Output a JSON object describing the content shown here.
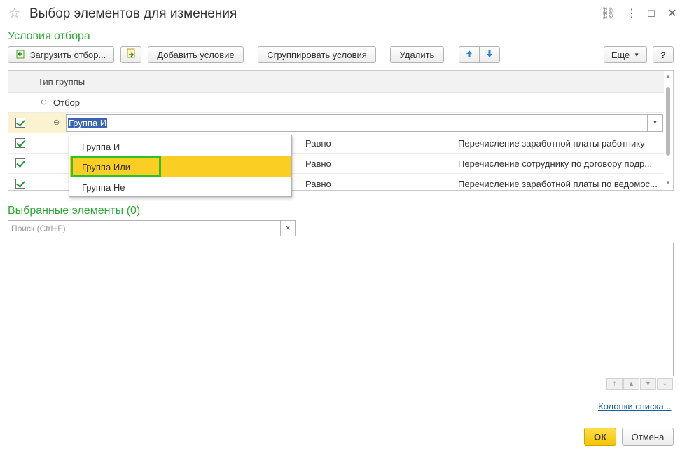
{
  "window": {
    "title": "Выбор элементов для изменения",
    "link_icon": "⛓",
    "menu_icon": "⋮",
    "maximize_icon": "☐",
    "close_icon": "✕"
  },
  "filter": {
    "section_title": "Условия отбора",
    "toolbar": {
      "load_filter": "Загрузить отбор...",
      "add_condition": "Добавить условие",
      "group_conditions": "Сгруппировать условия",
      "delete": "Удалить",
      "more": "Еще",
      "help": "?"
    },
    "table": {
      "header": "Тип группы",
      "rows": [
        {
          "label": "Отбор"
        },
        {
          "label": "Группа И",
          "checked": true
        },
        {
          "checked": true,
          "condition": "Равно",
          "value": "Перечисление заработной платы работнику"
        },
        {
          "checked": true,
          "condition": "Равно",
          "value": "Перечисление сотруднику по договору подр..."
        },
        {
          "checked": true,
          "condition": "Равно",
          "value": "Перечисление заработной платы по ведомос..."
        }
      ]
    },
    "dropdown": {
      "options": [
        "Группа И",
        "Группа Или",
        "Группа Не"
      ],
      "selected": "Группа Или"
    }
  },
  "selected": {
    "section_title": "Выбранные элементы (0)",
    "search_placeholder": "Поиск (Ctrl+F)",
    "clear": "×"
  },
  "footer": {
    "columns_link": "Колонки списка...",
    "ok": "ОК",
    "cancel": "Отмена"
  },
  "colors": {
    "accent_green": "#2ea836",
    "highlight_yellow": "#fbce24",
    "highlight_border": "#2bc22b",
    "link_blue": "#1a5fa8",
    "ok_yellow": "#f5c400"
  }
}
